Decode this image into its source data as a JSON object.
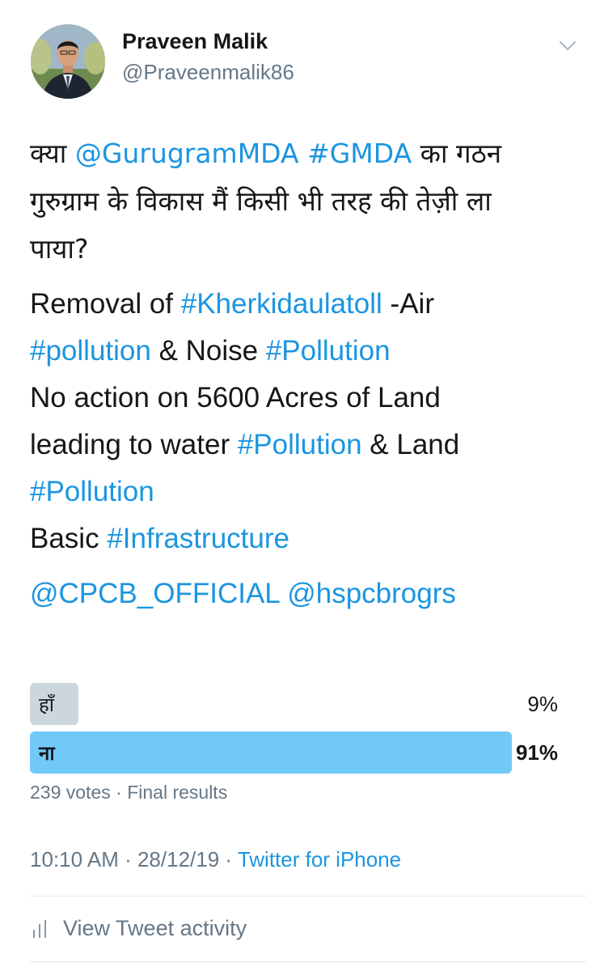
{
  "author": {
    "name": "Praveen Malik",
    "handle": "@Praveenmalik86"
  },
  "tweet": {
    "hindi_line_1": [
      {
        "text": "क्या ",
        "type": "text"
      },
      {
        "text": "@GurugramMDA",
        "type": "link"
      },
      {
        "text": " ",
        "type": "text"
      },
      {
        "text": "#GMDA",
        "type": "link"
      },
      {
        "text": " का गठन",
        "type": "text"
      }
    ],
    "hindi_line_2": "गुरुग्राम के विकास मैं किसी भी तरह की तेज़ी ला",
    "hindi_line_3": "पाया?",
    "p2": [
      {
        "text": "Removal of ",
        "type": "text"
      },
      {
        "text": "#Kherkidaulatoll",
        "type": "link"
      },
      {
        "text": " -Air",
        "type": "text"
      },
      {
        "br": true
      },
      {
        "text": "#pollution",
        "type": "link"
      },
      {
        "text": " & Noise ",
        "type": "text"
      },
      {
        "text": "#Pollution",
        "type": "link"
      },
      {
        "br": true
      },
      {
        "text": "No action on 5600 Acres of Land",
        "type": "text"
      },
      {
        "br": true
      },
      {
        "text": "leading to water ",
        "type": "text"
      },
      {
        "text": "#Pollution",
        "type": "link"
      },
      {
        "text": " & Land",
        "type": "text"
      },
      {
        "br": true
      },
      {
        "text": "#Pollution",
        "type": "link"
      },
      {
        "br": true
      },
      {
        "text": "Basic ",
        "type": "text"
      },
      {
        "text": "#Infrastructure",
        "type": "link"
      }
    ],
    "p3": [
      {
        "text": "@CPCB_OFFICIAL",
        "type": "link"
      },
      {
        "text": " ",
        "type": "text"
      },
      {
        "text": "@hspcbrogrs",
        "type": "link"
      }
    ]
  },
  "poll": {
    "options": [
      {
        "label": "हाँ",
        "percent_text": "9%",
        "percent": 9,
        "winner": false
      },
      {
        "label": "ना",
        "percent_text": "91%",
        "percent": 91,
        "winner": true
      }
    ],
    "votes": "239 votes",
    "separator": " · ",
    "status": "Final results"
  },
  "meta": {
    "time": "10:10 AM",
    "separator": " · ",
    "date": "28/12/19",
    "source": "Twitter for iPhone"
  },
  "activity": {
    "label": "View Tweet activity",
    "icon": "stats-icon"
  },
  "colors": {
    "link": "#1b95e0",
    "winner_bar": "#71c9f8",
    "loser_bar": "#ccd6dd",
    "secondary_text": "#657786"
  }
}
